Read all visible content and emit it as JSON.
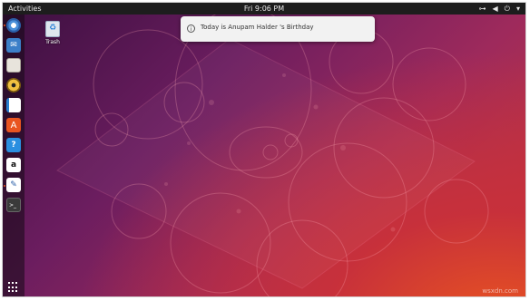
{
  "topbar": {
    "activities": "Activities",
    "clock": "Fri 9:06 PM",
    "tray_icons": [
      "network-icon",
      "volume-icon",
      "power-icon",
      "menu-arrow-icon"
    ]
  },
  "notification": {
    "text": "Today is Anupam Halder 's Birthday",
    "icon": "info-icon"
  },
  "desktop": {
    "trash_label": "Trash"
  },
  "dock": {
    "items": [
      "chromium",
      "thunderbird",
      "files",
      "rhythmbox",
      "libreoffice-writer",
      "software-center",
      "help",
      "amazon",
      "text-editor",
      "terminal"
    ],
    "show_apps": "show-applications"
  },
  "watermark": "wsxdn.com",
  "colors": {
    "accent": "#e95420",
    "topbar": "#1d1d1d",
    "wallpaper_dark": "#3a0f3f",
    "wallpaper_light": "#c9383a"
  }
}
